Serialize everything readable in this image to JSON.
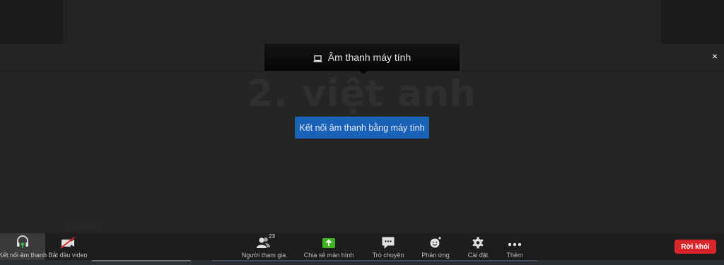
{
  "audio_tab": {
    "label": "Âm thanh máy tính",
    "icon": "laptop-icon"
  },
  "close": {
    "label": "×"
  },
  "participant": {
    "display_name": "2. việt anh",
    "name_tag": "2. việt anh"
  },
  "join_audio_button": {
    "label": "Kết nối âm thanh bằng máy tính"
  },
  "toolbar": {
    "join_audio": {
      "label": "Kết nối âm thanh",
      "icon": "headphones-icon"
    },
    "start_video": {
      "label": "Bắt đầu video",
      "icon": "video-off-icon"
    },
    "participants": {
      "label": "Người tham gia",
      "count": "23",
      "icon": "participants-icon"
    },
    "share_screen": {
      "label": "Chia sẻ màn hình",
      "icon": "share-screen-icon",
      "color": "#3cb521"
    },
    "chat": {
      "label": "Trò chuyện",
      "icon": "chat-icon"
    },
    "reactions": {
      "label": "Phản ứng",
      "icon": "smiley-icon"
    },
    "settings": {
      "label": "Cài đặt",
      "icon": "gear-icon"
    },
    "more": {
      "label": "Thêm",
      "icon": "more-icon"
    },
    "leave": {
      "label": "Rời khỏi",
      "color": "#d9262b"
    }
  }
}
